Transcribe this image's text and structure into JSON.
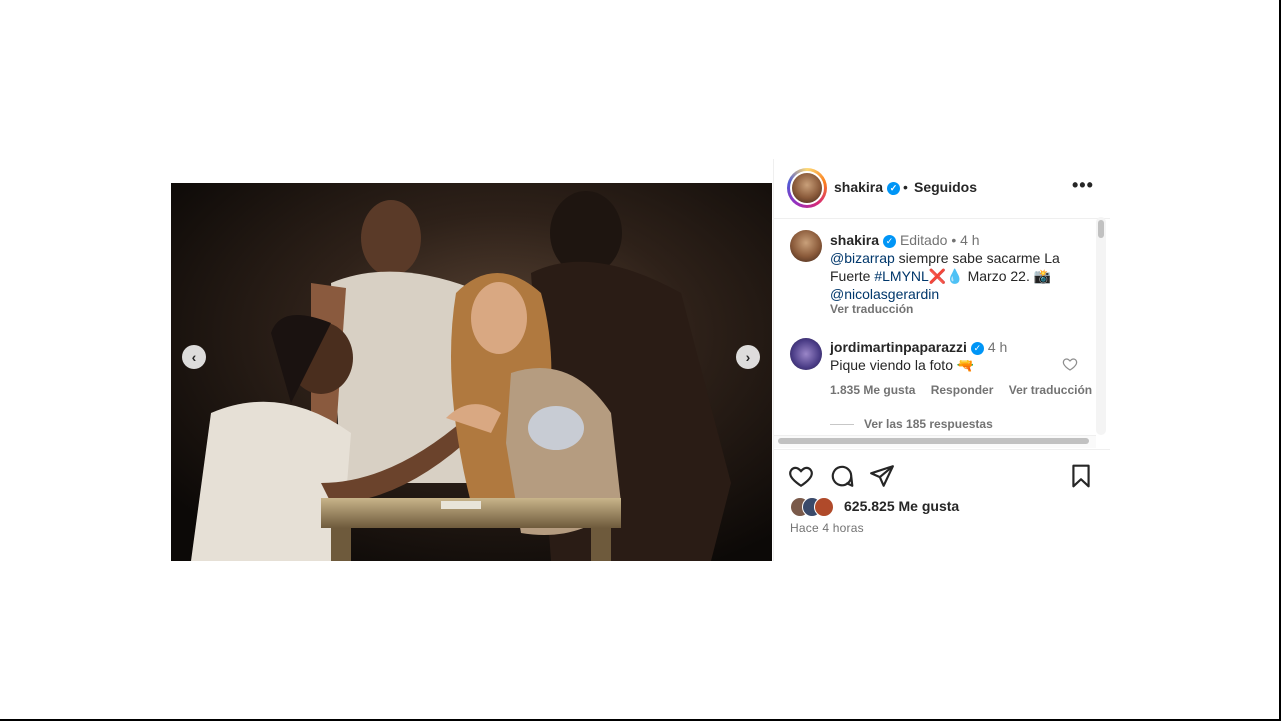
{
  "header": {
    "username": "shakira",
    "separator": "•",
    "follow_status": "Seguidos",
    "more_label": "•••"
  },
  "caption": {
    "username": "shakira",
    "edited": "Editado",
    "dot": "•",
    "time": "4 h",
    "mention1": "@bizarrap",
    "text1": " siempre sabe sacarme La Fuerte ",
    "hashtag": "#LMYNL",
    "emoji1": "❌💧",
    "text2": " Marzo 22. ",
    "emoji2": "📸",
    "mention2": "@nicolasgerardin",
    "translate": "Ver traducción"
  },
  "comment": {
    "username": "jordimartinpaparazzi",
    "time": "4 h",
    "text": "Pique viendo la foto ",
    "emoji": "🔫",
    "likes": "1.835 Me gusta",
    "reply": "Responder",
    "translate": "Ver traducción",
    "view_replies": "Ver las 185 respuestas"
  },
  "actions": {
    "likes_count": "625.825 Me gusta",
    "time_ago": "Hace 4 horas"
  },
  "media": {
    "prev_label": "‹",
    "next_label": "›"
  },
  "colors": {
    "verified": "#0095f6",
    "link": "#00376b",
    "muted": "#737373"
  }
}
